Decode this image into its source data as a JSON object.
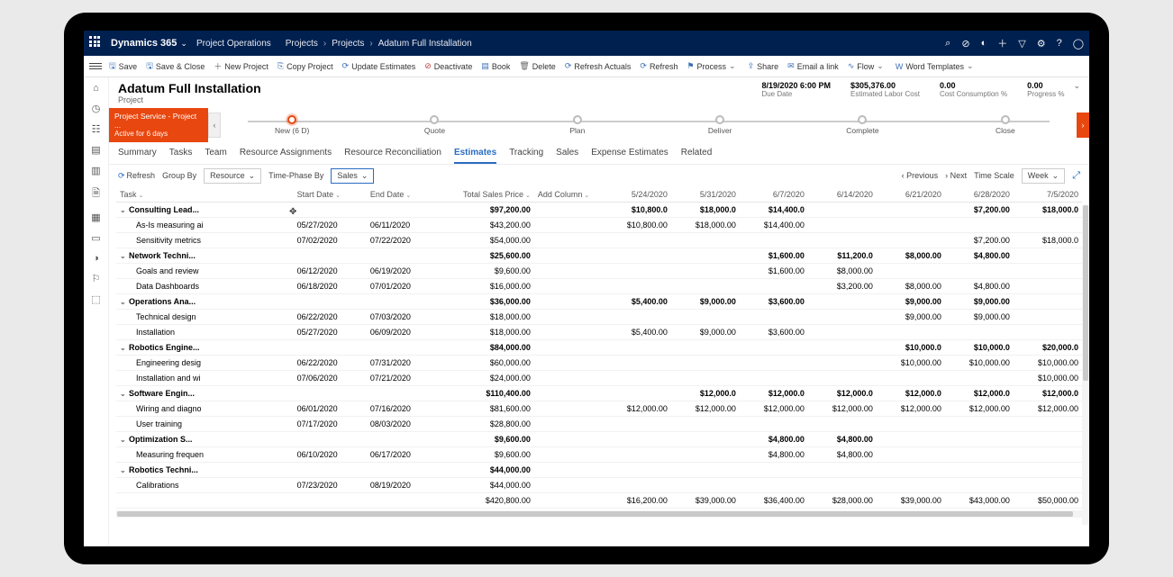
{
  "topbar": {
    "brand": "Dynamics 365",
    "app": "Project Operations",
    "crumbs": [
      "Projects",
      "Projects",
      "Adatum Full Installation"
    ]
  },
  "commands": {
    "save": "Save",
    "saveClose": "Save & Close",
    "new": "New Project",
    "copy": "Copy Project",
    "update": "Update Estimates",
    "deactivate": "Deactivate",
    "book": "Book",
    "delete": "Delete",
    "refreshActuals": "Refresh Actuals",
    "refresh": "Refresh",
    "process": "Process",
    "share": "Share",
    "email": "Email a link",
    "flow": "Flow",
    "word": "Word Templates"
  },
  "header": {
    "title": "Adatum Full Installation",
    "subtitle": "Project",
    "metrics": [
      {
        "value": "8/19/2020 6:00 PM",
        "label": "Due Date"
      },
      {
        "value": "$305,376.00",
        "label": "Estimated Labor Cost"
      },
      {
        "value": "0.00",
        "label": "Cost Consumption %"
      },
      {
        "value": "0.00",
        "label": "Progress %"
      }
    ]
  },
  "banner": {
    "line1": "Project Service - Project ...",
    "line2": "Active for 6 days"
  },
  "stages": [
    {
      "label": "New  (6 D)",
      "active": true
    },
    {
      "label": "Quote",
      "active": false
    },
    {
      "label": "Plan",
      "active": false
    },
    {
      "label": "Deliver",
      "active": false
    },
    {
      "label": "Complete",
      "active": false
    },
    {
      "label": "Close",
      "active": false
    }
  ],
  "tabs": [
    "Summary",
    "Tasks",
    "Team",
    "Resource Assignments",
    "Resource Reconciliation",
    "Estimates",
    "Tracking",
    "Sales",
    "Expense Estimates",
    "Related"
  ],
  "activeTab": "Estimates",
  "gridControls": {
    "refresh": "Refresh",
    "groupBy": "Group By",
    "groupByValue": "Resource",
    "timePhase": "Time-Phase By",
    "timePhaseValue": "Sales",
    "previous": "Previous",
    "next": "Next",
    "timeScale": "Time Scale",
    "timeScaleValue": "Week"
  },
  "columns": {
    "task": "Task",
    "start": "Start Date",
    "end": "End Date",
    "total": "Total Sales Price",
    "add": "Add Column",
    "dates": [
      "5/24/2020",
      "5/31/2020",
      "6/7/2020",
      "6/14/2020",
      "6/21/2020",
      "6/28/2020",
      "7/5/2020"
    ]
  },
  "rows": [
    {
      "type": "grp",
      "task": "Consulting Lead...",
      "total": "$97,200.00",
      "d": [
        "",
        "$10,800.0",
        "$18,000.0",
        "$14,400.0",
        "",
        "",
        "$7,200.00",
        "$18,000.0"
      ]
    },
    {
      "type": "child",
      "task": "As-Is measuring ai",
      "start": "05/27/2020",
      "end": "06/11/2020",
      "total": "$43,200.00",
      "d": [
        "",
        "$10,800.00",
        "$18,000.00",
        "$14,400.00",
        "",
        "",
        "",
        ""
      ]
    },
    {
      "type": "child",
      "task": "Sensitivity metrics",
      "start": "07/02/2020",
      "end": "07/22/2020",
      "total": "$54,000.00",
      "d": [
        "",
        "",
        "",
        "",
        "",
        "",
        "$7,200.00",
        "$18,000.0"
      ]
    },
    {
      "type": "grp",
      "task": "Network Techni...",
      "total": "$25,600.00",
      "d": [
        "",
        "",
        "",
        "$1,600.00",
        "$11,200.0",
        "$8,000.00",
        "$4,800.00",
        ""
      ]
    },
    {
      "type": "child",
      "task": "Goals and review",
      "start": "06/12/2020",
      "end": "06/19/2020",
      "total": "$9,600.00",
      "d": [
        "",
        "",
        "",
        "$1,600.00",
        "$8,000.00",
        "",
        "",
        ""
      ]
    },
    {
      "type": "child",
      "task": "Data Dashboards",
      "start": "06/18/2020",
      "end": "07/01/2020",
      "total": "$16,000.00",
      "d": [
        "",
        "",
        "",
        "",
        "$3,200.00",
        "$8,000.00",
        "$4,800.00",
        ""
      ]
    },
    {
      "type": "grp",
      "task": "Operations Ana...",
      "total": "$36,000.00",
      "d": [
        "",
        "$5,400.00",
        "$9,000.00",
        "$3,600.00",
        "",
        "$9,000.00",
        "$9,000.00",
        ""
      ]
    },
    {
      "type": "child",
      "task": "Technical design",
      "start": "06/22/2020",
      "end": "07/03/2020",
      "total": "$18,000.00",
      "d": [
        "",
        "",
        "",
        "",
        "",
        "$9,000.00",
        "$9,000.00",
        ""
      ]
    },
    {
      "type": "child",
      "task": "Installation",
      "start": "05/27/2020",
      "end": "06/09/2020",
      "total": "$18,000.00",
      "d": [
        "",
        "$5,400.00",
        "$9,000.00",
        "$3,600.00",
        "",
        "",
        "",
        ""
      ]
    },
    {
      "type": "grp",
      "task": "Robotics Engine...",
      "total": "$84,000.00",
      "d": [
        "",
        "",
        "",
        "",
        "",
        "$10,000.0",
        "$10,000.0",
        "$20,000.0"
      ]
    },
    {
      "type": "child",
      "task": "Engineering desig",
      "start": "06/22/2020",
      "end": "07/31/2020",
      "total": "$60,000.00",
      "d": [
        "",
        "",
        "",
        "",
        "",
        "$10,000.00",
        "$10,000.00",
        "$10,000.00"
      ]
    },
    {
      "type": "child",
      "task": "Installation and wi",
      "start": "07/06/2020",
      "end": "07/21/2020",
      "total": "$24,000.00",
      "d": [
        "",
        "",
        "",
        "",
        "",
        "",
        "",
        "$10,000.00"
      ]
    },
    {
      "type": "grp",
      "task": "Software Engin...",
      "total": "$110,400.00",
      "d": [
        "",
        "",
        "$12,000.0",
        "$12,000.0",
        "$12,000.0",
        "$12,000.0",
        "$12,000.0",
        "$12,000.0"
      ]
    },
    {
      "type": "child",
      "task": "Wiring and diagno",
      "start": "06/01/2020",
      "end": "07/16/2020",
      "total": "$81,600.00",
      "d": [
        "",
        "$12,000.00",
        "$12,000.00",
        "$12,000.00",
        "$12,000.00",
        "$12,000.00",
        "$12,000.00",
        "$12,000.00"
      ]
    },
    {
      "type": "child",
      "task": "User training",
      "start": "07/17/2020",
      "end": "08/03/2020",
      "total": "$28,800.00",
      "d": [
        "",
        "",
        "",
        "",
        "",
        "",
        "",
        ""
      ]
    },
    {
      "type": "grp",
      "task": "Optimization S...",
      "total": "$9,600.00",
      "d": [
        "",
        "",
        "",
        "$4,800.00",
        "$4,800.00",
        "",
        "",
        ""
      ]
    },
    {
      "type": "child",
      "task": "Measuring frequen",
      "start": "06/10/2020",
      "end": "06/17/2020",
      "total": "$9,600.00",
      "d": [
        "",
        "",
        "",
        "$4,800.00",
        "$4,800.00",
        "",
        "",
        ""
      ]
    },
    {
      "type": "grp",
      "task": "Robotics Techni...",
      "total": "$44,000.00",
      "d": [
        "",
        "",
        "",
        "",
        "",
        "",
        "",
        ""
      ]
    },
    {
      "type": "child",
      "task": "Calibrations",
      "start": "07/23/2020",
      "end": "08/19/2020",
      "total": "$44,000.00",
      "d": [
        "",
        "",
        "",
        "",
        "",
        "",
        "",
        ""
      ]
    }
  ],
  "totals": {
    "total": "$420,800.00",
    "d": [
      "",
      "$16,200.00",
      "$39,000.00",
      "$36,400.00",
      "$28,000.00",
      "$39,000.00",
      "$43,000.00",
      "$50,000.00"
    ]
  }
}
